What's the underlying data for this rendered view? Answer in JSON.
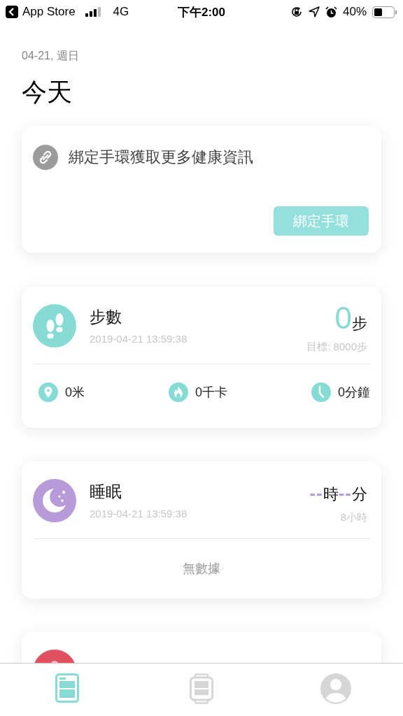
{
  "status_bar": {
    "back_label": "App Store",
    "network": "4G",
    "time": "下午2:00",
    "battery_text": "40%"
  },
  "header": {
    "date": "04-21, 週日",
    "title": "今天"
  },
  "bind_card": {
    "message": "綁定手環獲取更多健康資訊",
    "button": "綁定手環"
  },
  "cards": [
    {
      "kind": "steps",
      "title": "步數",
      "timestamp": "2019-04-21 13:59:38",
      "value": "0",
      "unit": "步",
      "goal": "目標: 8000步",
      "metrics": [
        {
          "kind": "distance",
          "value": "0米"
        },
        {
          "kind": "calories",
          "value": "0千卡"
        },
        {
          "kind": "duration",
          "value": "0分鐘"
        }
      ]
    },
    {
      "kind": "sleep",
      "title": "睡眠",
      "timestamp": "2019-04-21 13:59:38",
      "hours": "--",
      "hours_unit": "時",
      "minutes": "--",
      "minutes_unit": "分",
      "goal": "8小時",
      "empty_text": "無數據"
    },
    {
      "kind": "gps"
    }
  ],
  "tabs": [
    {
      "kind": "today",
      "selected": true
    },
    {
      "kind": "device",
      "selected": false
    },
    {
      "kind": "profile",
      "selected": false
    }
  ]
}
